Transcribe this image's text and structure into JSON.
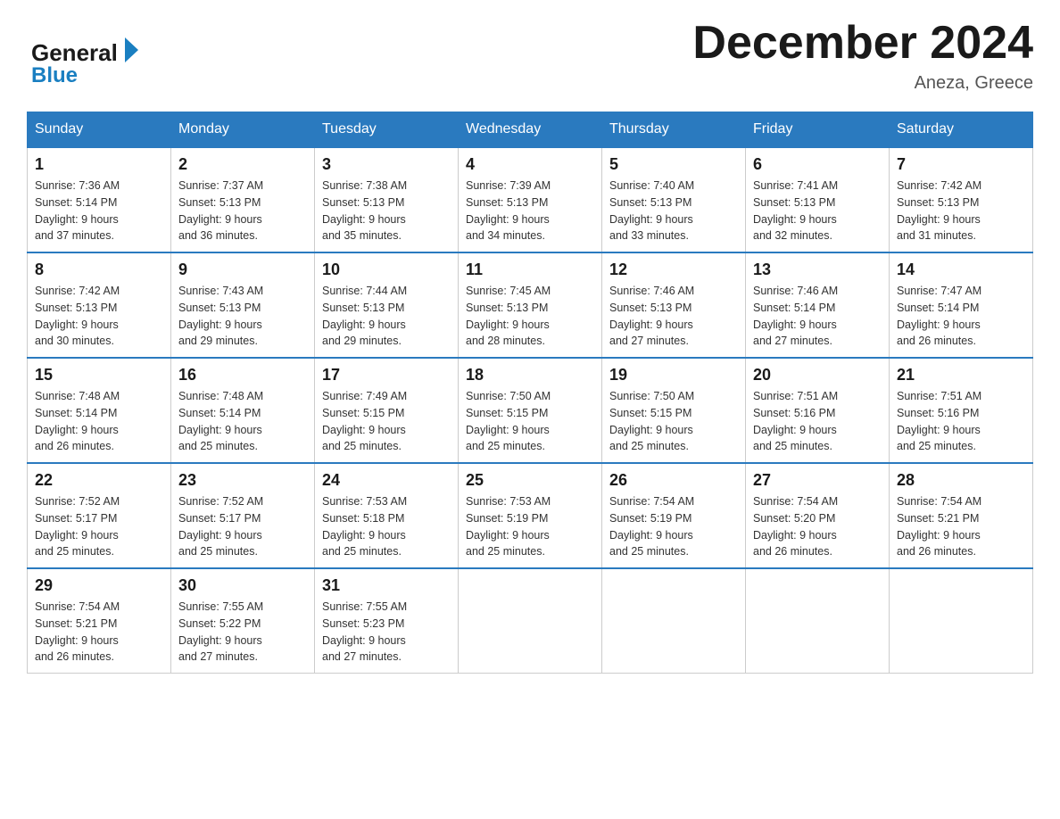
{
  "header": {
    "logo_general": "General",
    "logo_blue": "Blue",
    "main_title": "December 2024",
    "subtitle": "Aneza, Greece"
  },
  "days_of_week": [
    "Sunday",
    "Monday",
    "Tuesday",
    "Wednesday",
    "Thursday",
    "Friday",
    "Saturday"
  ],
  "weeks": [
    [
      {
        "day": "1",
        "sunrise": "Sunrise: 7:36 AM",
        "sunset": "Sunset: 5:14 PM",
        "daylight": "Daylight: 9 hours",
        "daylight2": "and 37 minutes."
      },
      {
        "day": "2",
        "sunrise": "Sunrise: 7:37 AM",
        "sunset": "Sunset: 5:13 PM",
        "daylight": "Daylight: 9 hours",
        "daylight2": "and 36 minutes."
      },
      {
        "day": "3",
        "sunrise": "Sunrise: 7:38 AM",
        "sunset": "Sunset: 5:13 PM",
        "daylight": "Daylight: 9 hours",
        "daylight2": "and 35 minutes."
      },
      {
        "day": "4",
        "sunrise": "Sunrise: 7:39 AM",
        "sunset": "Sunset: 5:13 PM",
        "daylight": "Daylight: 9 hours",
        "daylight2": "and 34 minutes."
      },
      {
        "day": "5",
        "sunrise": "Sunrise: 7:40 AM",
        "sunset": "Sunset: 5:13 PM",
        "daylight": "Daylight: 9 hours",
        "daylight2": "and 33 minutes."
      },
      {
        "day": "6",
        "sunrise": "Sunrise: 7:41 AM",
        "sunset": "Sunset: 5:13 PM",
        "daylight": "Daylight: 9 hours",
        "daylight2": "and 32 minutes."
      },
      {
        "day": "7",
        "sunrise": "Sunrise: 7:42 AM",
        "sunset": "Sunset: 5:13 PM",
        "daylight": "Daylight: 9 hours",
        "daylight2": "and 31 minutes."
      }
    ],
    [
      {
        "day": "8",
        "sunrise": "Sunrise: 7:42 AM",
        "sunset": "Sunset: 5:13 PM",
        "daylight": "Daylight: 9 hours",
        "daylight2": "and 30 minutes."
      },
      {
        "day": "9",
        "sunrise": "Sunrise: 7:43 AM",
        "sunset": "Sunset: 5:13 PM",
        "daylight": "Daylight: 9 hours",
        "daylight2": "and 29 minutes."
      },
      {
        "day": "10",
        "sunrise": "Sunrise: 7:44 AM",
        "sunset": "Sunset: 5:13 PM",
        "daylight": "Daylight: 9 hours",
        "daylight2": "and 29 minutes."
      },
      {
        "day": "11",
        "sunrise": "Sunrise: 7:45 AM",
        "sunset": "Sunset: 5:13 PM",
        "daylight": "Daylight: 9 hours",
        "daylight2": "and 28 minutes."
      },
      {
        "day": "12",
        "sunrise": "Sunrise: 7:46 AM",
        "sunset": "Sunset: 5:13 PM",
        "daylight": "Daylight: 9 hours",
        "daylight2": "and 27 minutes."
      },
      {
        "day": "13",
        "sunrise": "Sunrise: 7:46 AM",
        "sunset": "Sunset: 5:14 PM",
        "daylight": "Daylight: 9 hours",
        "daylight2": "and 27 minutes."
      },
      {
        "day": "14",
        "sunrise": "Sunrise: 7:47 AM",
        "sunset": "Sunset: 5:14 PM",
        "daylight": "Daylight: 9 hours",
        "daylight2": "and 26 minutes."
      }
    ],
    [
      {
        "day": "15",
        "sunrise": "Sunrise: 7:48 AM",
        "sunset": "Sunset: 5:14 PM",
        "daylight": "Daylight: 9 hours",
        "daylight2": "and 26 minutes."
      },
      {
        "day": "16",
        "sunrise": "Sunrise: 7:48 AM",
        "sunset": "Sunset: 5:14 PM",
        "daylight": "Daylight: 9 hours",
        "daylight2": "and 25 minutes."
      },
      {
        "day": "17",
        "sunrise": "Sunrise: 7:49 AM",
        "sunset": "Sunset: 5:15 PM",
        "daylight": "Daylight: 9 hours",
        "daylight2": "and 25 minutes."
      },
      {
        "day": "18",
        "sunrise": "Sunrise: 7:50 AM",
        "sunset": "Sunset: 5:15 PM",
        "daylight": "Daylight: 9 hours",
        "daylight2": "and 25 minutes."
      },
      {
        "day": "19",
        "sunrise": "Sunrise: 7:50 AM",
        "sunset": "Sunset: 5:15 PM",
        "daylight": "Daylight: 9 hours",
        "daylight2": "and 25 minutes."
      },
      {
        "day": "20",
        "sunrise": "Sunrise: 7:51 AM",
        "sunset": "Sunset: 5:16 PM",
        "daylight": "Daylight: 9 hours",
        "daylight2": "and 25 minutes."
      },
      {
        "day": "21",
        "sunrise": "Sunrise: 7:51 AM",
        "sunset": "Sunset: 5:16 PM",
        "daylight": "Daylight: 9 hours",
        "daylight2": "and 25 minutes."
      }
    ],
    [
      {
        "day": "22",
        "sunrise": "Sunrise: 7:52 AM",
        "sunset": "Sunset: 5:17 PM",
        "daylight": "Daylight: 9 hours",
        "daylight2": "and 25 minutes."
      },
      {
        "day": "23",
        "sunrise": "Sunrise: 7:52 AM",
        "sunset": "Sunset: 5:17 PM",
        "daylight": "Daylight: 9 hours",
        "daylight2": "and 25 minutes."
      },
      {
        "day": "24",
        "sunrise": "Sunrise: 7:53 AM",
        "sunset": "Sunset: 5:18 PM",
        "daylight": "Daylight: 9 hours",
        "daylight2": "and 25 minutes."
      },
      {
        "day": "25",
        "sunrise": "Sunrise: 7:53 AM",
        "sunset": "Sunset: 5:19 PM",
        "daylight": "Daylight: 9 hours",
        "daylight2": "and 25 minutes."
      },
      {
        "day": "26",
        "sunrise": "Sunrise: 7:54 AM",
        "sunset": "Sunset: 5:19 PM",
        "daylight": "Daylight: 9 hours",
        "daylight2": "and 25 minutes."
      },
      {
        "day": "27",
        "sunrise": "Sunrise: 7:54 AM",
        "sunset": "Sunset: 5:20 PM",
        "daylight": "Daylight: 9 hours",
        "daylight2": "and 26 minutes."
      },
      {
        "day": "28",
        "sunrise": "Sunrise: 7:54 AM",
        "sunset": "Sunset: 5:21 PM",
        "daylight": "Daylight: 9 hours",
        "daylight2": "and 26 minutes."
      }
    ],
    [
      {
        "day": "29",
        "sunrise": "Sunrise: 7:54 AM",
        "sunset": "Sunset: 5:21 PM",
        "daylight": "Daylight: 9 hours",
        "daylight2": "and 26 minutes."
      },
      {
        "day": "30",
        "sunrise": "Sunrise: 7:55 AM",
        "sunset": "Sunset: 5:22 PM",
        "daylight": "Daylight: 9 hours",
        "daylight2": "and 27 minutes."
      },
      {
        "day": "31",
        "sunrise": "Sunrise: 7:55 AM",
        "sunset": "Sunset: 5:23 PM",
        "daylight": "Daylight: 9 hours",
        "daylight2": "and 27 minutes."
      },
      null,
      null,
      null,
      null
    ]
  ]
}
